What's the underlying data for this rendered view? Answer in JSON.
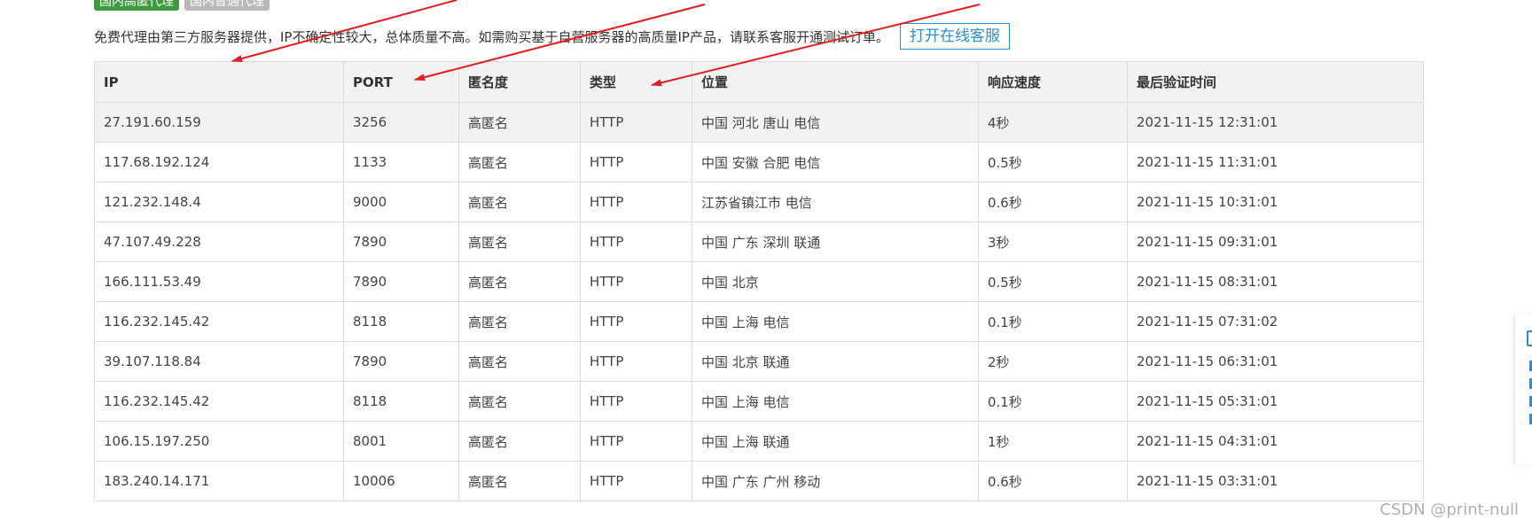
{
  "tabs": [
    {
      "label": "国内高匿代理",
      "active": true
    },
    {
      "label": "国内普通代理",
      "active": false
    }
  ],
  "notice": {
    "text": "免费代理由第三方服务器提供，IP不确定性较大，总体质量不高。如需购买基于自营服务器的高质量IP产品，请联系客服开通测试订单。",
    "button_label": "打开在线客服"
  },
  "table": {
    "headers": [
      "IP",
      "PORT",
      "匿名度",
      "类型",
      "位置",
      "响应速度",
      "最后验证时间"
    ],
    "rows": [
      [
        "27.191.60.159",
        "3256",
        "高匿名",
        "HTTP",
        "中国 河北 唐山 电信",
        "4秒",
        "2021-11-15 12:31:01"
      ],
      [
        "117.68.192.124",
        "1133",
        "高匿名",
        "HTTP",
        "中国 安徽 合肥 电信",
        "0.5秒",
        "2021-11-15 11:31:01"
      ],
      [
        "121.232.148.4",
        "9000",
        "高匿名",
        "HTTP",
        "江苏省镇江市 电信",
        "0.6秒",
        "2021-11-15 10:31:01"
      ],
      [
        "47.107.49.228",
        "7890",
        "高匿名",
        "HTTP",
        "中国 广东 深圳 联通",
        "3秒",
        "2021-11-15 09:31:01"
      ],
      [
        "166.111.53.49",
        "7890",
        "高匿名",
        "HTTP",
        "中国 北京",
        "0.5秒",
        "2021-11-15 08:31:01"
      ],
      [
        "116.232.145.42",
        "8118",
        "高匿名",
        "HTTP",
        "中国 上海 电信",
        "0.1秒",
        "2021-11-15 07:31:02"
      ],
      [
        "39.107.118.84",
        "7890",
        "高匿名",
        "HTTP",
        "中国 北京 联通",
        "2秒",
        "2021-11-15 06:31:01"
      ],
      [
        "116.232.145.42",
        "8118",
        "高匿名",
        "HTTP",
        "中国 上海 电信",
        "0.1秒",
        "2021-11-15 05:31:01"
      ],
      [
        "106.15.197.250",
        "8001",
        "高匿名",
        "HTTP",
        "中国 上海 联通",
        "1秒",
        "2021-11-15 04:31:01"
      ],
      [
        "183.240.14.171",
        "10006",
        "高匿名",
        "HTTP",
        "中国 广东 广州 移动",
        "0.6秒",
        "2021-11-15 03:31:01"
      ]
    ]
  },
  "watermark": "CSDN @print-null",
  "colors": {
    "tab_active": "#3e9a3e",
    "tab_inactive": "#b8b8b8",
    "button_accent": "#2a8fd6",
    "header_bg": "#f2f2f2",
    "border": "#dddddd",
    "arrow": "#e8191c"
  },
  "icons": {
    "annotation": "red-arrow-icon",
    "side_widget": "chat-icon"
  }
}
